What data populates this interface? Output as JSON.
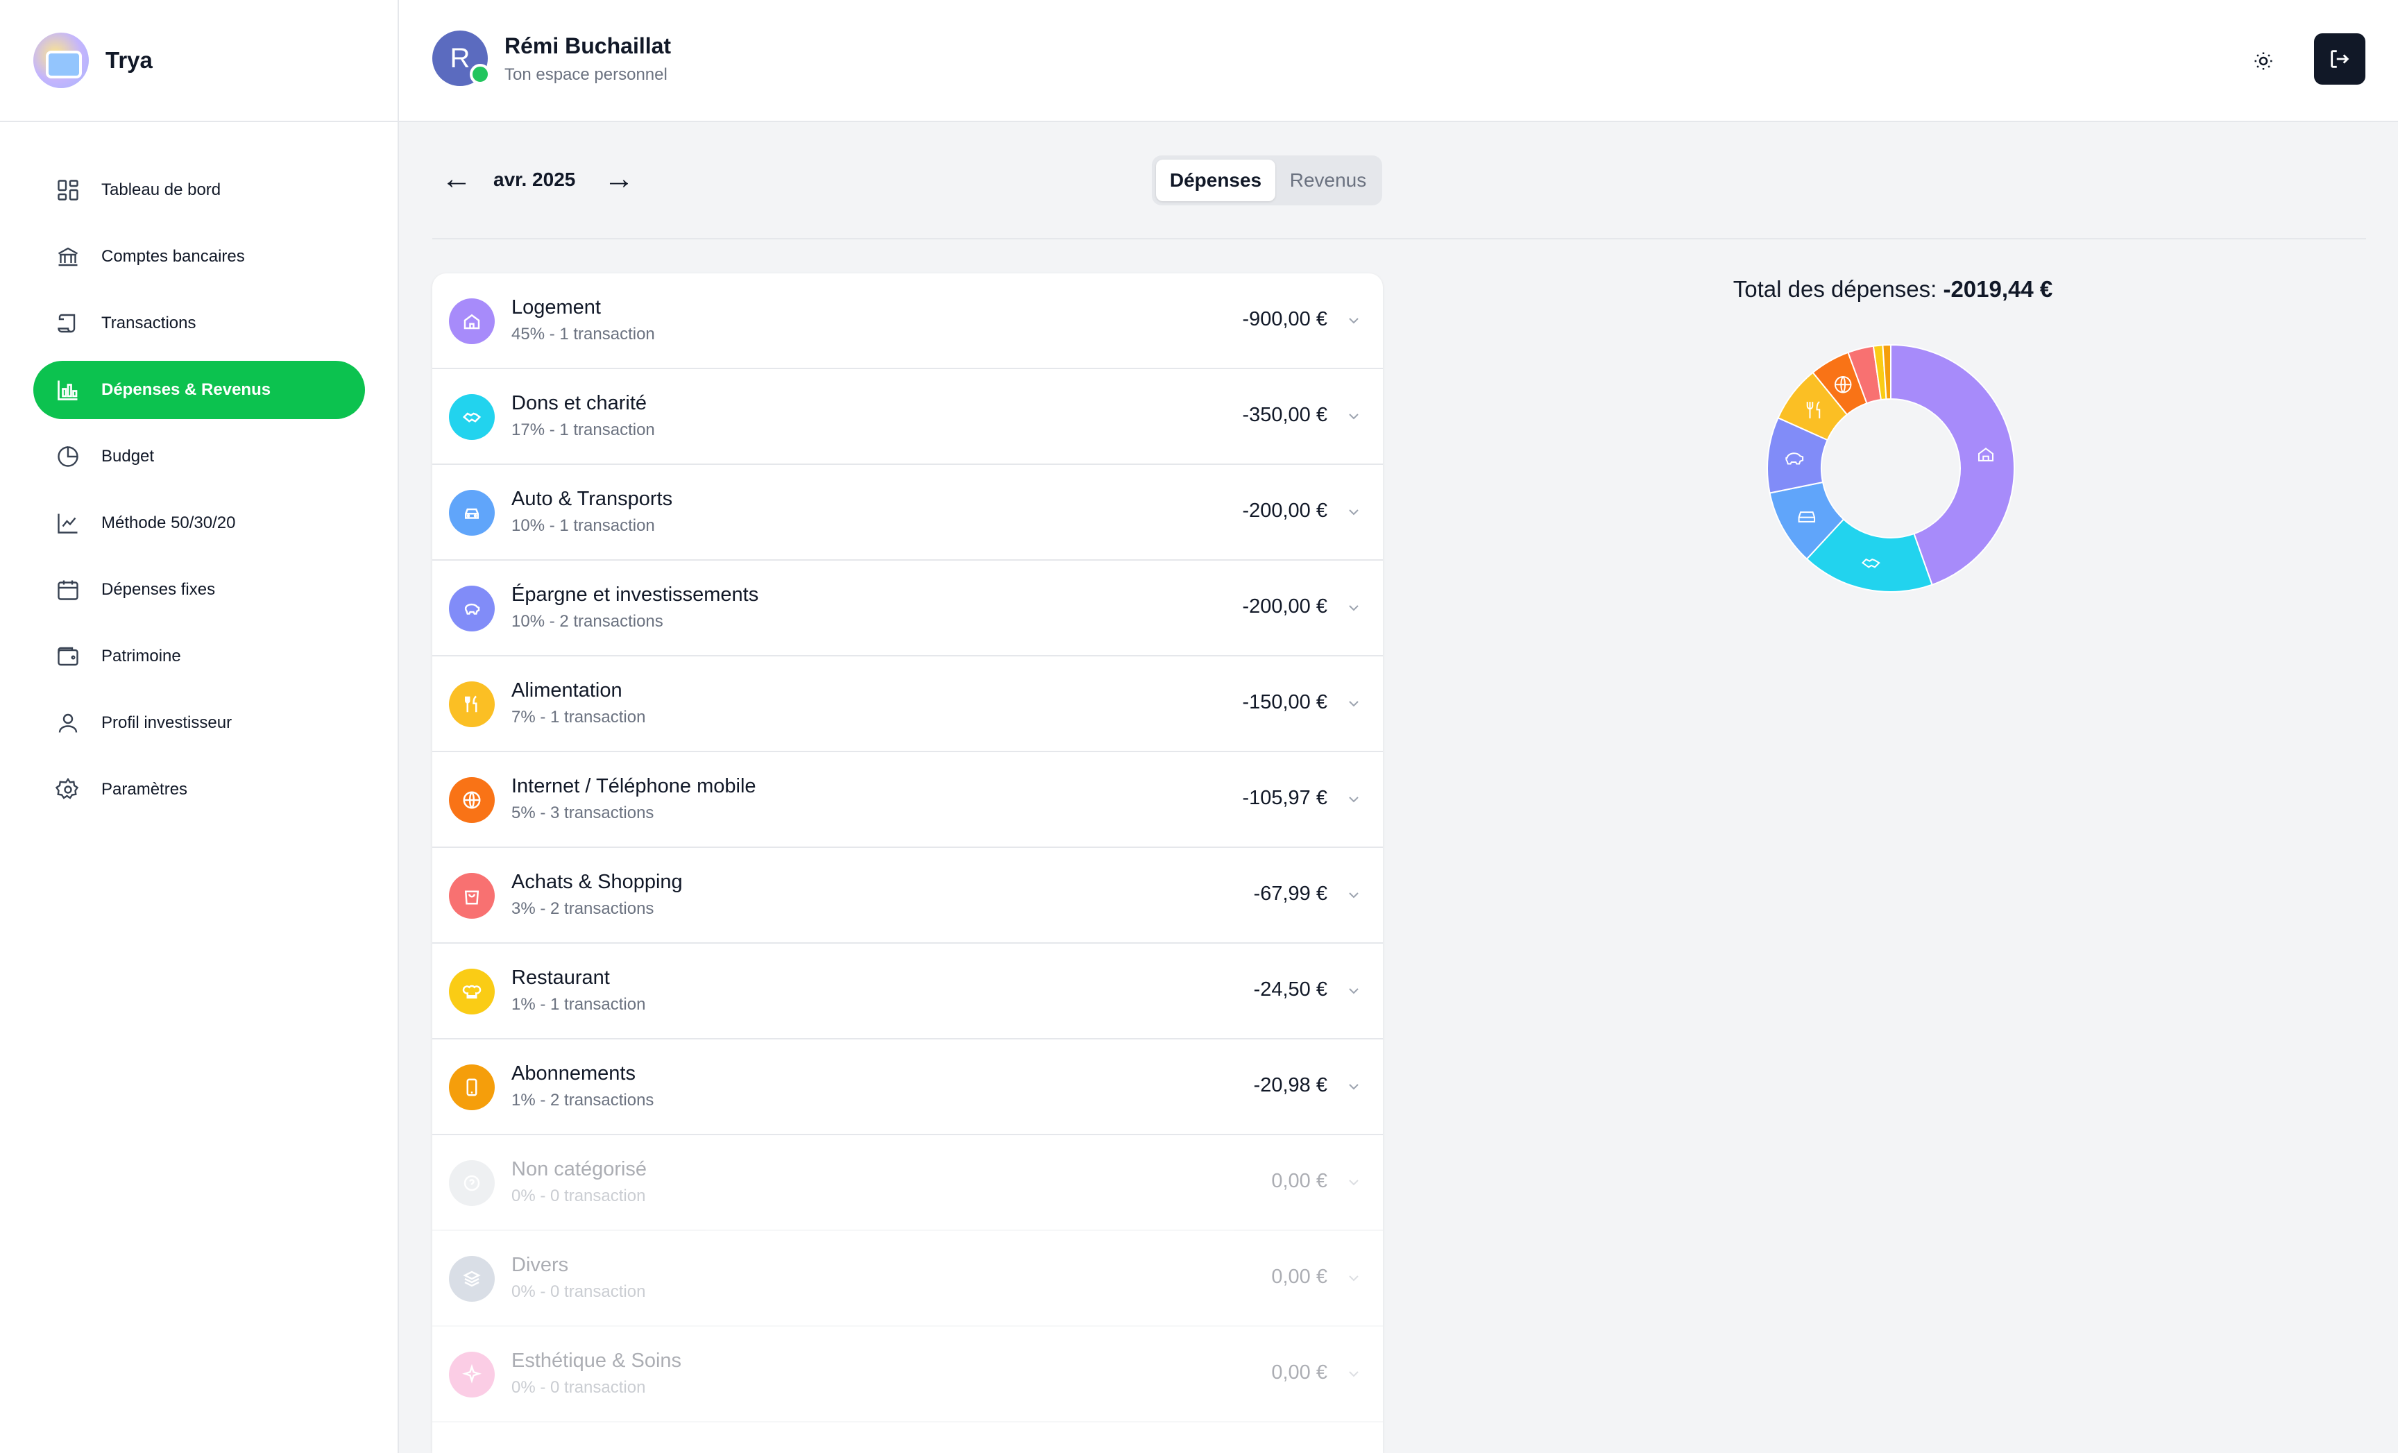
{
  "app": {
    "name": "Trya"
  },
  "sidebar": {
    "items": [
      {
        "label": "Tableau de bord",
        "icon": "dashboard-icon"
      },
      {
        "label": "Comptes bancaires",
        "icon": "bank-icon"
      },
      {
        "label": "Transactions",
        "icon": "scroll-icon"
      },
      {
        "label": "Dépenses & Revenus",
        "icon": "bar-chart-icon",
        "active": true
      },
      {
        "label": "Budget",
        "icon": "pie-chart-icon"
      },
      {
        "label": "Méthode 50/30/20",
        "icon": "line-chart-icon"
      },
      {
        "label": "Dépenses fixes",
        "icon": "calendar-icon"
      },
      {
        "label": "Patrimoine",
        "icon": "wallet-icon"
      },
      {
        "label": "Profil investisseur",
        "icon": "user-icon"
      },
      {
        "label": "Paramètres",
        "icon": "gear-icon"
      }
    ]
  },
  "header": {
    "avatar_initial": "R",
    "user_name": "Rémi Buchaillat",
    "subtitle": "Ton espace personnel"
  },
  "period": {
    "prev": "←",
    "label": "avr. 2025",
    "next": "→"
  },
  "toggle": {
    "expenses": "Dépenses",
    "income": "Revenus",
    "selected": "Dépenses"
  },
  "categories": [
    {
      "name": "Logement",
      "meta": "45% - 1 transaction",
      "amount": "-900,00 €",
      "color": "#a78bfa",
      "icon": "home-icon"
    },
    {
      "name": "Dons et charité",
      "meta": "17% - 1 transaction",
      "amount": "-350,00 €",
      "color": "#22d3ee",
      "icon": "handshake-icon"
    },
    {
      "name": "Auto & Transports",
      "meta": "10% - 1 transaction",
      "amount": "-200,00 €",
      "color": "#60a5fa",
      "icon": "car-icon"
    },
    {
      "name": "Épargne et investissements",
      "meta": "10% - 2 transactions",
      "amount": "-200,00 €",
      "color": "#818cf8",
      "icon": "piggy-bank-icon"
    },
    {
      "name": "Alimentation",
      "meta": "7% - 1 transaction",
      "amount": "-150,00 €",
      "color": "#fbbf24",
      "icon": "utensils-icon"
    },
    {
      "name": "Internet / Téléphone mobile",
      "meta": "5% - 3 transactions",
      "amount": "-105,97 €",
      "color": "#f97316",
      "icon": "globe-icon"
    },
    {
      "name": "Achats & Shopping",
      "meta": "3% - 2 transactions",
      "amount": "-67,99 €",
      "color": "#f87171",
      "icon": "shopping-bag-icon"
    },
    {
      "name": "Restaurant",
      "meta": "1% - 1 transaction",
      "amount": "-24,50 €",
      "color": "#facc15",
      "icon": "chef-hat-icon"
    },
    {
      "name": "Abonnements",
      "meta": "1% - 2 transactions",
      "amount": "-20,98 €",
      "color": "#f59e0b",
      "icon": "phone-icon"
    },
    {
      "name": "Non catégorisé",
      "meta": "0% - 0 transaction",
      "amount": "0,00 €",
      "color": "#d1d5db",
      "icon": "question-icon",
      "dim": true
    },
    {
      "name": "Divers",
      "meta": "0% - 0 transaction",
      "amount": "0,00 €",
      "color": "#94a3b8",
      "icon": "layers-icon",
      "dim": true
    },
    {
      "name": "Esthétique & Soins",
      "meta": "0% - 0 transaction",
      "amount": "0,00 €",
      "color": "#f472b6",
      "icon": "sparkle-icon",
      "dim": true
    }
  ],
  "chart": {
    "title_prefix": "Total des dépenses: ",
    "total": "-2019,44 €"
  },
  "chart_data": {
    "type": "pie",
    "donut": true,
    "title": "Total des dépenses: -2019,44 €",
    "categories": [
      "Logement",
      "Dons et charité",
      "Auto & Transports",
      "Épargne et investissements",
      "Alimentation",
      "Internet / Téléphone mobile",
      "Achats & Shopping",
      "Restaurant",
      "Abonnements"
    ],
    "values": [
      900.0,
      350.0,
      200.0,
      200.0,
      150.0,
      105.97,
      67.99,
      24.5,
      20.98
    ],
    "colors": [
      "#a78bfa",
      "#22d3ee",
      "#60a5fa",
      "#818cf8",
      "#fbbf24",
      "#f97316",
      "#f87171",
      "#facc15",
      "#f59e0b"
    ],
    "icons": [
      "home-icon",
      "handshake-icon",
      "car-icon",
      "piggy-bank-icon",
      "utensils-icon",
      "globe-icon",
      "",
      "",
      ""
    ]
  }
}
